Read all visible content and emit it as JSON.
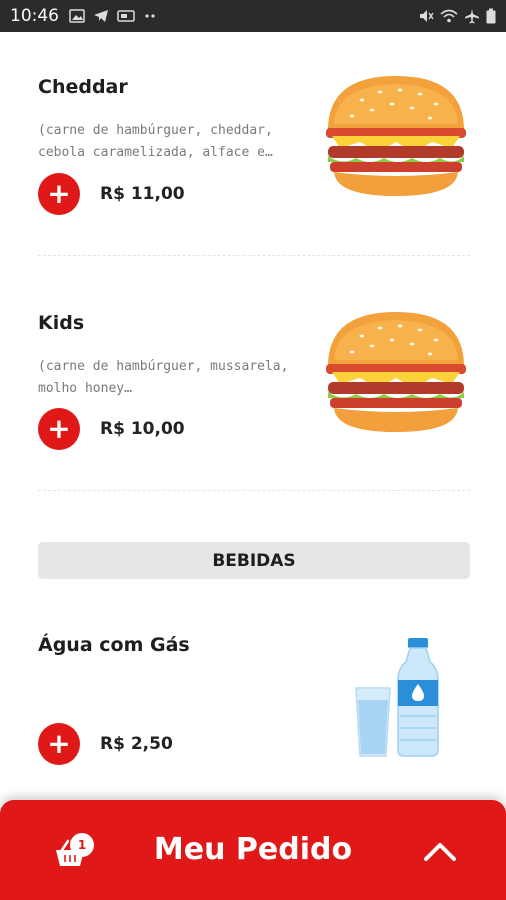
{
  "status_bar": {
    "time": "10:46",
    "left_icons": [
      "image-icon",
      "telegram-icon",
      "card-icon",
      "more-dots-icon"
    ],
    "right_icons": [
      "mute-icon",
      "wifi-icon",
      "airplane-icon",
      "battery-icon"
    ]
  },
  "products": [
    {
      "name": "Cheddar",
      "description": "(carne de hambúrguer, cheddar, cebola caramelizada, alface e…",
      "price": "R$ 11,00",
      "image": "burger-icon"
    },
    {
      "name": "Kids",
      "description": "(carne de hambúrguer, mussarela, molho honey…",
      "price": "R$ 10,00",
      "image": "burger-icon"
    }
  ],
  "section": {
    "title": "BEBIDAS"
  },
  "drinks": [
    {
      "name": "Água com Gás",
      "description": "",
      "price": "R$ 2,50",
      "image": "water-bottle-icon"
    }
  ],
  "add_button": {
    "label": "+"
  },
  "bottom_bar": {
    "label": "Meu Pedido",
    "cart_count": "1",
    "cart_icon": "cart-icon",
    "toggle_icon": "chevron-up-icon"
  },
  "colors": {
    "brand_red": "#e01818",
    "status_bar": "#2b2b2b",
    "section_bg": "#e6e6e6"
  }
}
